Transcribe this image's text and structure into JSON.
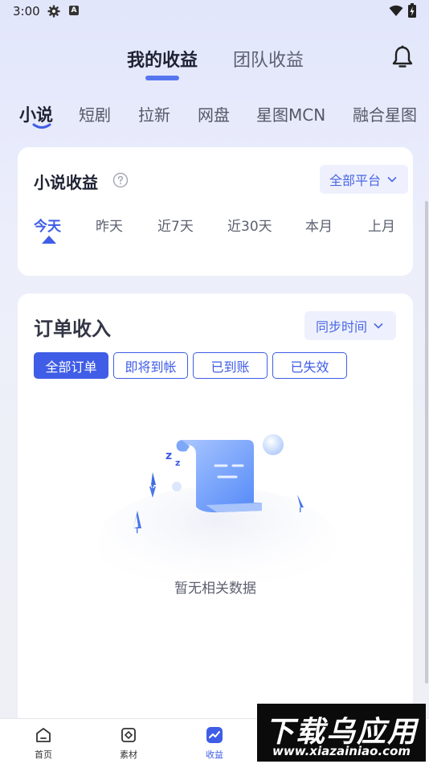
{
  "status_bar": {
    "time": "3:00",
    "badge_letter": "A"
  },
  "header": {
    "tabs": [
      {
        "label": "我的收益",
        "active": true
      },
      {
        "label": "团队收益",
        "active": false
      }
    ],
    "notification_icon": "bell-icon"
  },
  "categories": [
    {
      "label": "小说",
      "active": true
    },
    {
      "label": "短剧",
      "active": false
    },
    {
      "label": "拉新",
      "active": false
    },
    {
      "label": "网盘",
      "active": false
    },
    {
      "label": "星图MCN",
      "active": false
    },
    {
      "label": "融合星图",
      "active": false
    }
  ],
  "earnings_card": {
    "title": "小说收益",
    "help_icon": "question-circle-icon",
    "platform_select": "全部平台",
    "periods": [
      {
        "label": "今天",
        "active": true
      },
      {
        "label": "昨天",
        "active": false
      },
      {
        "label": "近7天",
        "active": false
      },
      {
        "label": "近30天",
        "active": false
      },
      {
        "label": "本月",
        "active": false
      },
      {
        "label": "上月",
        "active": false
      }
    ]
  },
  "orders_card": {
    "title": "订单收入",
    "sort_select": "同步时间",
    "filters": [
      {
        "label": "全部订单",
        "active": true
      },
      {
        "label": "即将到帐",
        "active": false
      },
      {
        "label": "已到账",
        "active": false
      },
      {
        "label": "已失效",
        "active": false
      }
    ],
    "empty_text": "暂无相关数据"
  },
  "bottom_nav": [
    {
      "label": "首页",
      "icon": "home-icon",
      "active": false
    },
    {
      "label": "素材",
      "icon": "material-icon",
      "active": false
    },
    {
      "label": "收益",
      "icon": "earnings-chart-icon",
      "active": true
    }
  ],
  "watermark": {
    "title": "下载乌应用",
    "url": "www.xiazainiao.com"
  },
  "colors": {
    "accent": "#3f5de6",
    "tab_indicator": "#5676f0",
    "select_bg": "#eef1fd"
  }
}
